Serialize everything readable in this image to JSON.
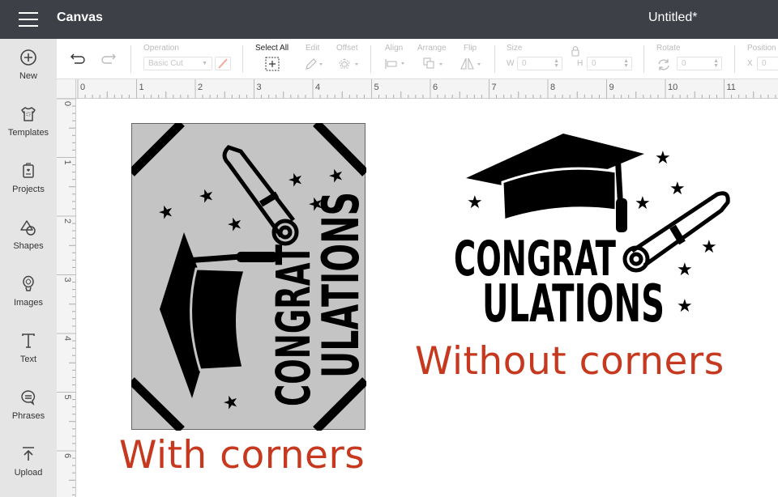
{
  "header": {
    "app_title": "Canvas",
    "document_title": "Untitled*"
  },
  "sidebar": {
    "items": [
      {
        "label": "New",
        "icon": "plus-circle-icon"
      },
      {
        "label": "Templates",
        "icon": "tshirt-icon"
      },
      {
        "label": "Projects",
        "icon": "projects-icon"
      },
      {
        "label": "Shapes",
        "icon": "shapes-icon"
      },
      {
        "label": "Images",
        "icon": "balloon-icon"
      },
      {
        "label": "Text",
        "icon": "text-icon"
      },
      {
        "label": "Phrases",
        "icon": "speech-bubble-icon"
      },
      {
        "label": "Upload",
        "icon": "upload-icon"
      }
    ]
  },
  "toolbar": {
    "operation_label": "Operation",
    "operation_value": "Basic Cut",
    "select_all_label": "Select All",
    "edit_label": "Edit",
    "offset_label": "Offset",
    "align_label": "Align",
    "arrange_label": "Arrange",
    "flip_label": "Flip",
    "size_label": "Size",
    "width_label": "W",
    "width_value": "0",
    "height_label": "H",
    "height_value": "0",
    "rotate_label": "Rotate",
    "rotate_value": "0",
    "position_label": "Position",
    "x_label": "X",
    "x_value": "0",
    "pen_color": "#f2a99a"
  },
  "rulers": {
    "horizontal": [
      "0",
      "1",
      "2",
      "3",
      "4",
      "5",
      "6",
      "7",
      "8",
      "9",
      "10",
      "11"
    ],
    "vertical": [
      "0",
      "1",
      "2",
      "3",
      "4",
      "5",
      "6"
    ]
  },
  "canvas": {
    "design_text_line1": "CONGRAT",
    "design_text_line2": "ULATIONS",
    "caption_with": "With corners",
    "caption_without": "Without corners",
    "caption_color": "#c7391f"
  }
}
